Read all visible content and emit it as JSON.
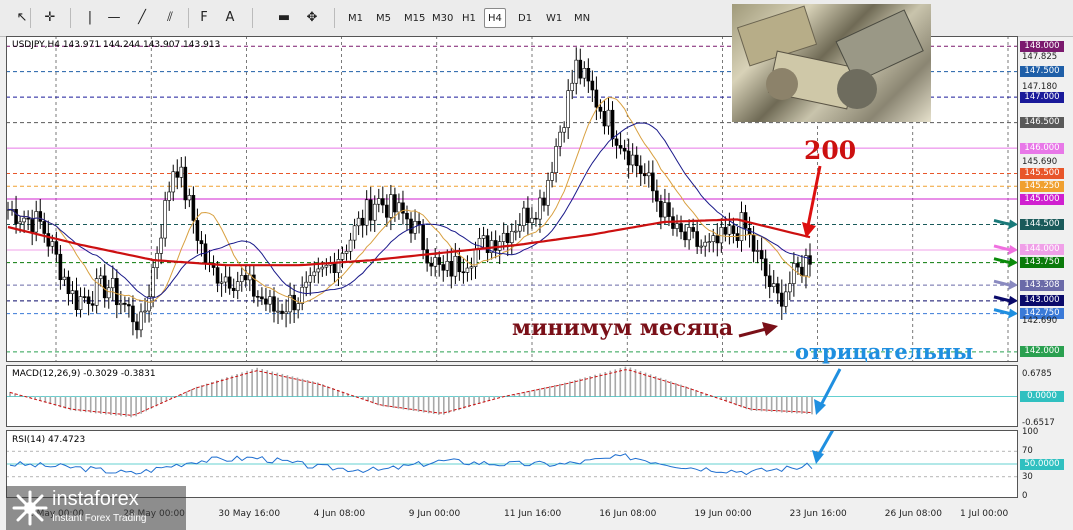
{
  "toolbar": {
    "tools": [
      {
        "name": "cursor-tool-icon",
        "label": "↖"
      },
      {
        "name": "crosshair-tool-icon",
        "label": "✛"
      },
      {
        "name": "vertical-line-tool-icon",
        "label": "|"
      },
      {
        "name": "horizontal-line-tool-icon",
        "label": "—"
      },
      {
        "name": "trendline-tool-icon",
        "label": "╱"
      },
      {
        "name": "channel-tool-icon",
        "label": "⫽"
      },
      {
        "name": "fibonacci-tool-icon",
        "label": "F"
      },
      {
        "name": "text-tool-icon",
        "label": "A"
      },
      {
        "name": "label-tool-icon",
        "label": "▬"
      },
      {
        "name": "shapes-tool-icon",
        "label": "✥"
      }
    ],
    "timeframes": [
      "M1",
      "M5",
      "M15",
      "M30",
      "H1",
      "H4",
      "D1",
      "W1",
      "MN"
    ],
    "active_timeframe": "H4"
  },
  "main": {
    "title": "USDJPY,H4  143.971 144.244 143.907 143.913"
  },
  "macd": {
    "title": "MACD(12,26,9) -0.3029 -0.3831",
    "scale": [
      "0.6785",
      "0.0000",
      "-0.6517"
    ],
    "zero_tag": "0.0000"
  },
  "rsi": {
    "title": "RSI(14) 47.4723",
    "scale": [
      "100",
      "70",
      "50.0000",
      "30",
      "0"
    ]
  },
  "price_axis": {
    "tags": [
      {
        "v": "148.000",
        "color": "#7b1a6e"
      },
      {
        "v": "147.500",
        "color": "#1f5fa8"
      },
      {
        "v": "147.000",
        "color": "#1a1a9a"
      },
      {
        "v": "146.500",
        "color": "#5a5a5a"
      },
      {
        "v": "146.000",
        "color": "#e878e8"
      },
      {
        "v": "145.500",
        "color": "#e8562a"
      },
      {
        "v": "145.250",
        "color": "#f0a030"
      },
      {
        "v": "145.000",
        "color": "#d020d0"
      },
      {
        "v": "144.500",
        "color": "#1a5a5a"
      },
      {
        "v": "144.000",
        "color": "#f0a0e8"
      },
      {
        "v": "143.750",
        "color": "#0a7a0a"
      },
      {
        "v": "143.308",
        "color": "#6a6aa8"
      },
      {
        "v": "143.000",
        "color": "#0a0a6a"
      },
      {
        "v": "142.750",
        "color": "#3a7ad8"
      },
      {
        "v": "142.000",
        "color": "#2aa050"
      }
    ],
    "plain": [
      "147.825",
      "147.180",
      "145.690",
      "142.690"
    ]
  },
  "time_axis": [
    "2 May 00:00",
    "28 May 00:00",
    "30 May 16:00",
    "4 Jun 08:00",
    "9 Jun 00:00",
    "11 Jun 16:00",
    "16 Jun 08:00",
    "19 Jun 00:00",
    "23 Jun 16:00",
    "26 Jun 08:00",
    "1 Jul 00:00"
  ],
  "annotations": {
    "ma200": "200",
    "month_low": "минимум месяца",
    "negative": "отрицательны"
  },
  "logo": {
    "name": "instaforex",
    "sub": "Instant Forex Trading"
  },
  "chart_data": {
    "type": "line",
    "title": "USDJPY,H4",
    "x": [
      "2 May 00:00",
      "28 May 00:00",
      "30 May 16:00",
      "4 Jun 08:00",
      "9 Jun 00:00",
      "11 Jun 16:00",
      "16 Jun 08:00",
      "19 Jun 00:00",
      "23 Jun 16:00",
      "26 Jun 08:00",
      "1 Jul 00:00"
    ],
    "ylim": [
      141.8,
      148.2
    ],
    "horizontal_levels": [
      148.0,
      147.5,
      147.0,
      146.5,
      146.0,
      145.5,
      145.25,
      145.0,
      144.5,
      144.0,
      143.75,
      143.308,
      143.0,
      142.75,
      142.0
    ],
    "series": [
      {
        "name": "USDJPY,H4",
        "values": [
          144.8,
          144.5,
          143.0,
          143.3,
          142.5,
          145.8,
          143.6,
          143.4,
          142.8,
          143.2,
          144.0,
          145.0,
          144.6,
          143.5,
          144.0,
          144.4,
          145.0,
          147.6,
          146.5,
          145.5,
          144.3,
          144.0,
          144.5,
          143.0,
          143.9
        ]
      },
      {
        "name": "MA200",
        "values": [
          144.45,
          144.1,
          143.8,
          143.7,
          143.7,
          143.8,
          143.95,
          144.1,
          144.3,
          144.55,
          144.6,
          144.25
        ]
      }
    ],
    "macd": {
      "values": [
        0.1,
        -0.3,
        -0.45,
        0.2,
        0.62,
        0.3,
        -0.2,
        -0.4,
        0.0,
        0.3,
        0.65,
        0.2,
        -0.3,
        -0.38
      ],
      "ylim": [
        -0.6517,
        0.6785
      ]
    },
    "rsi": {
      "values": [
        50,
        45,
        35,
        55,
        60,
        45,
        40,
        55,
        50,
        50,
        62,
        45,
        38,
        47
      ],
      "ylim": [
        0,
        100
      ],
      "levels": [
        70,
        50,
        30
      ]
    }
  }
}
